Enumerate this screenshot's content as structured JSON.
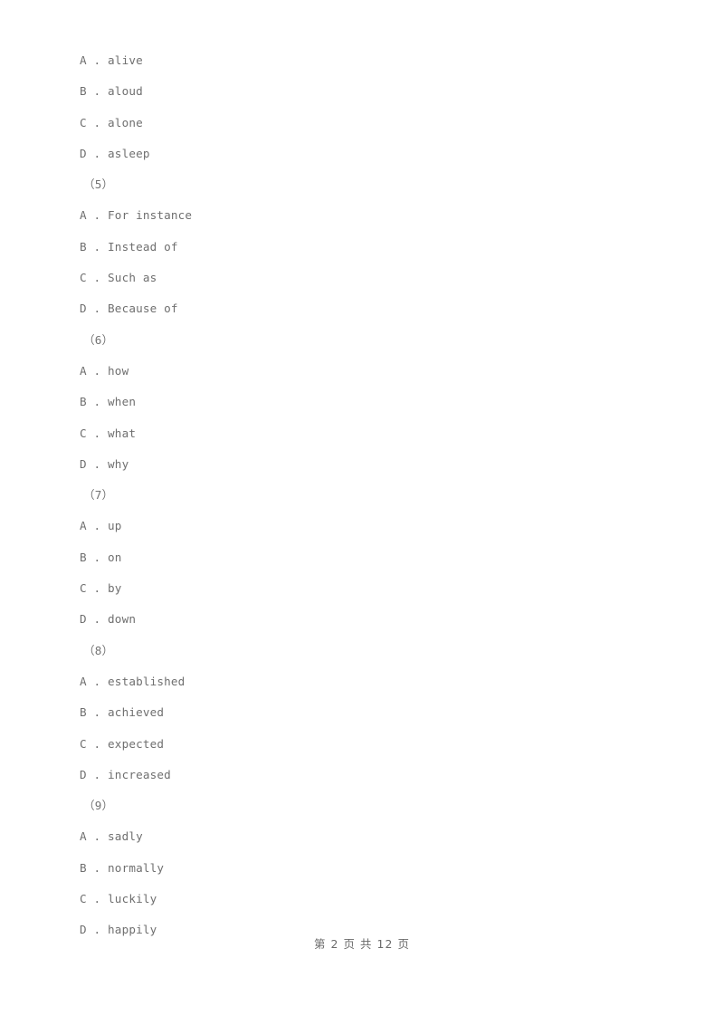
{
  "page": {
    "background_color": "#ffffff",
    "text_color": "#6f6f6f"
  },
  "content": {
    "lines": [
      {
        "kind": "option",
        "text": "A . alive"
      },
      {
        "kind": "option",
        "text": "B . aloud"
      },
      {
        "kind": "option",
        "text": "C . alone"
      },
      {
        "kind": "option",
        "text": "D . asleep"
      },
      {
        "kind": "qnum",
        "text": "（5）"
      },
      {
        "kind": "option",
        "text": "A . For instance"
      },
      {
        "kind": "option",
        "text": "B . Instead of"
      },
      {
        "kind": "option",
        "text": "C . Such as"
      },
      {
        "kind": "option",
        "text": "D . Because of"
      },
      {
        "kind": "qnum",
        "text": "（6）"
      },
      {
        "kind": "option",
        "text": "A . how"
      },
      {
        "kind": "option",
        "text": "B . when"
      },
      {
        "kind": "option",
        "text": "C . what"
      },
      {
        "kind": "option",
        "text": "D . why"
      },
      {
        "kind": "qnum",
        "text": "（7）"
      },
      {
        "kind": "option",
        "text": "A . up"
      },
      {
        "kind": "option",
        "text": "B . on"
      },
      {
        "kind": "option",
        "text": "C . by"
      },
      {
        "kind": "option",
        "text": "D . down"
      },
      {
        "kind": "qnum",
        "text": "（8）"
      },
      {
        "kind": "option",
        "text": "A . established"
      },
      {
        "kind": "option",
        "text": "B . achieved"
      },
      {
        "kind": "option",
        "text": "C . expected"
      },
      {
        "kind": "option",
        "text": "D . increased"
      },
      {
        "kind": "qnum",
        "text": "（9）"
      },
      {
        "kind": "option",
        "text": "A . sadly"
      },
      {
        "kind": "option",
        "text": "B . normally"
      },
      {
        "kind": "option",
        "text": "C . luckily"
      },
      {
        "kind": "option",
        "text": "D . happily"
      }
    ]
  },
  "footer": {
    "text": "第 2 页 共 12 页",
    "current_page": "2",
    "total_pages": "12"
  }
}
